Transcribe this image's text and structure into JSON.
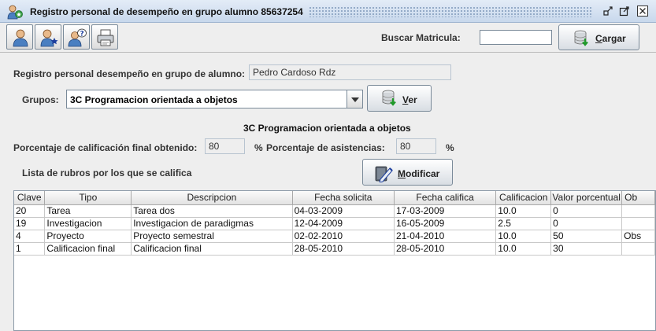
{
  "window": {
    "title": "Registro personal de desempeño en grupo alumno 85637254",
    "app_icon": "users-icon",
    "controls": [
      "minimize-icon",
      "maximize-icon",
      "close-icon"
    ]
  },
  "toolbar": {
    "buttons": [
      {
        "icon": "user-icon"
      },
      {
        "icon": "user-star-icon"
      },
      {
        "icon": "user-help-icon"
      },
      {
        "icon": "printer-icon"
      }
    ],
    "search_label": "Buscar Matricula:",
    "search_value": "",
    "load_label_underlined": "C",
    "load_label_rest": "argar",
    "load_icon": "database-download-icon"
  },
  "form": {
    "student_label": "Registro personal desempeño en grupo de alumno:",
    "student_name": "Pedro Cardoso Rdz",
    "groups_label": "Grupos:",
    "group_selected": "3C  Programacion orientada a objetos",
    "view_label_underlined": "V",
    "view_label_rest": "er",
    "group_heading": "3C  Programacion orientada a objetos",
    "final_pct_label": "Porcentaje de calificación final obtenido:",
    "final_pct_value": "80",
    "pct_sign_1": "%",
    "attendance_label": "Porcentaje de asistencias:",
    "attendance_value": "80",
    "pct_sign_2": "%",
    "rubros_label": "Lista de rubros por los que se califica",
    "modify_label_underlined": "M",
    "modify_label_rest": "odificar",
    "modify_icon": "edit-icon"
  },
  "table": {
    "columns": [
      "Clave",
      "Tipo",
      "Descripcion",
      "Fecha solicita",
      "Fecha califica",
      "Calificacion",
      "Valor porcentual",
      "Ob"
    ],
    "rows": [
      [
        "20",
        "Tarea",
        "Tarea dos",
        "04-03-2009",
        "17-03-2009",
        "10.0",
        "0",
        ""
      ],
      [
        "19",
        "Investigacion",
        "Investigacion de paradigmas",
        "12-04-2009",
        "16-05-2009",
        "2.5",
        "0",
        ""
      ],
      [
        "4",
        "Proyecto",
        "Proyecto semestral",
        "02-02-2010",
        "21-04-2010",
        "10.0",
        "50",
        "Obs"
      ],
      [
        "1",
        "Calificacion final",
        "Calificacion final",
        "28-05-2010",
        "28-05-2010",
        "10.0",
        "30",
        ""
      ]
    ]
  },
  "colors": {
    "title_bar": "#c8d8ec",
    "panel": "#eeeeee",
    "border": "#7a8a99"
  }
}
